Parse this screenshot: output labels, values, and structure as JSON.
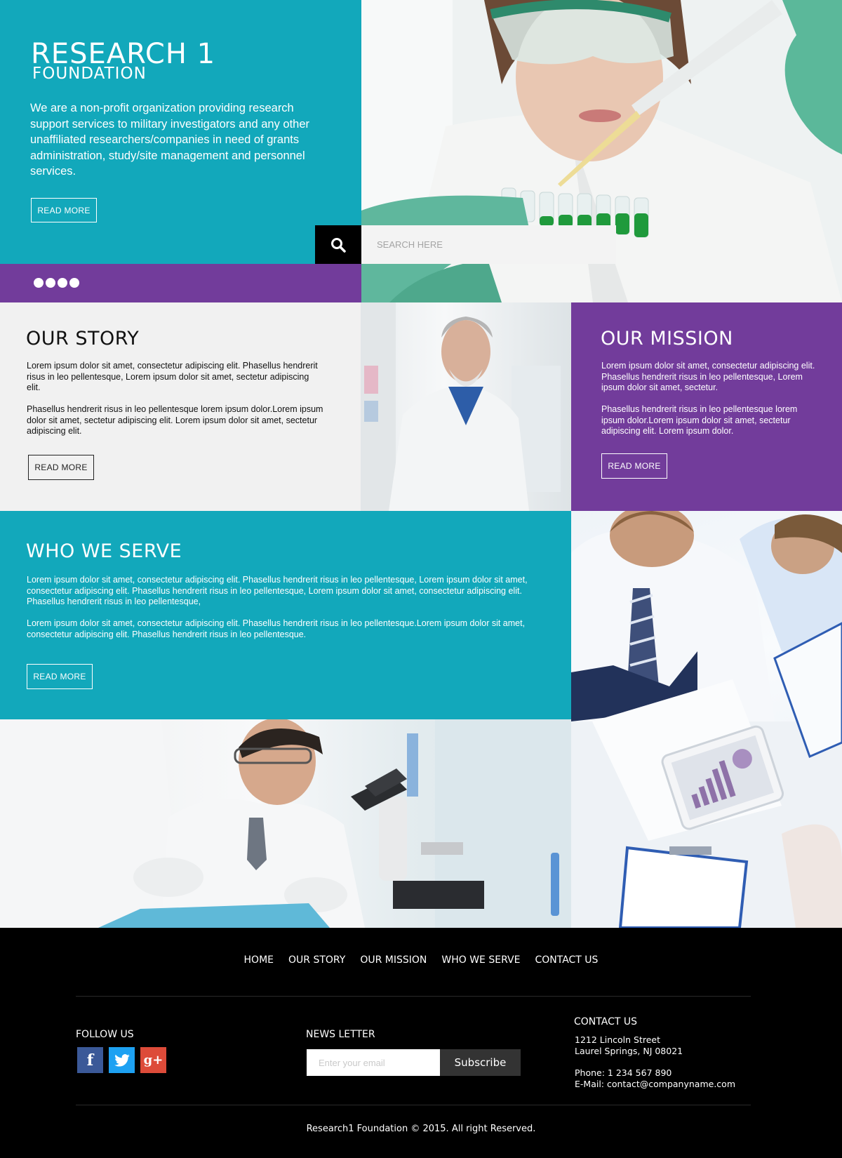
{
  "brand": {
    "name_line1": "RESEARCH 1",
    "name_line2": "FOUNDATION"
  },
  "hero": {
    "description": "We are a non-profit organization providing research support services to military investigators and any other unaffiliated researchers/companies in need of grants administration, study/site management and personnel services.",
    "read_more": "READ MORE",
    "search_placeholder": "SEARCH HERE",
    "slider_dots": 4
  },
  "story": {
    "title": "OUR STORY",
    "p1": "Lorem ipsum dolor sit amet, consectetur adipiscing elit. Phasellus hendrerit risus in leo pellentesque, Lorem ipsum dolor sit amet, sectetur adipiscing elit.",
    "p2": "Phasellus hendrerit risus in leo pellentesque lorem ipsum dolor.Lorem ipsum dolor sit amet, sectetur adipiscing elit. Lorem ipsum dolor sit amet, sectetur adipiscing elit.",
    "read_more": "READ MORE"
  },
  "mission": {
    "title": "OUR MISSION",
    "p1": "Lorem ipsum dolor sit amet, consectetur adipiscing elit. Phasellus hendrerit risus in leo pellentesque, Lorem ipsum dolor sit amet, sectetur.",
    "p2": "Phasellus hendrerit risus in leo pellentesque lorem ipsum dolor.Lorem ipsum dolor sit amet, sectetur adipiscing elit. Lorem ipsum dolor.",
    "read_more": "READ MORE"
  },
  "serve": {
    "title": "WHO WE SERVE",
    "p1": "Lorem ipsum dolor sit amet, consectetur adipiscing elit. Phasellus hendrerit risus in leo pellentesque, Lorem ipsum dolor sit amet, consectetur adipiscing elit. Phasellus hendrerit risus in leo pellentesque, Lorem ipsum dolor sit amet, consectetur adipiscing elit. Phasellus hendrerit risus in leo pellentesque,",
    "p2": "Lorem ipsum dolor sit amet, consectetur adipiscing elit. Phasellus hendrerit risus in leo pellentesque.Lorem ipsum dolor sit amet, consectetur adipiscing elit. Phasellus hendrerit risus in leo pellentesque.",
    "read_more": "READ MORE"
  },
  "footer": {
    "nav": [
      "HOME",
      "OUR STORY",
      "OUR MISSION",
      "WHO WE SERVE",
      "CONTACT US"
    ],
    "follow_title": "FOLLOW US",
    "social": {
      "facebook": "f",
      "twitter": "t",
      "google_plus": "g+"
    },
    "newsletter_title": "NEWS LETTER",
    "email_placeholder": "Enter your email",
    "subscribe": "Subscribe",
    "contact_title": "CONTACT US",
    "address_line1": "1212 Lincoln Street",
    "address_line2": "Laurel Springs, NJ 08021",
    "phone": "Phone: 1 234 567 890",
    "email": "E-Mail: contact@companyname.com",
    "copyright": "Research1 Foundation © 2015. All right Reserved."
  },
  "colors": {
    "teal": "#12a8bb",
    "purple": "#723c9b",
    "light_gray": "#f1f1f1",
    "black": "#000000",
    "facebook": "#3b5998",
    "twitter": "#1da1f2",
    "google_plus": "#dd4b39"
  },
  "icons": {
    "search": "search-icon",
    "facebook": "facebook-icon",
    "twitter": "twitter-icon",
    "google_plus": "google-plus-icon"
  }
}
